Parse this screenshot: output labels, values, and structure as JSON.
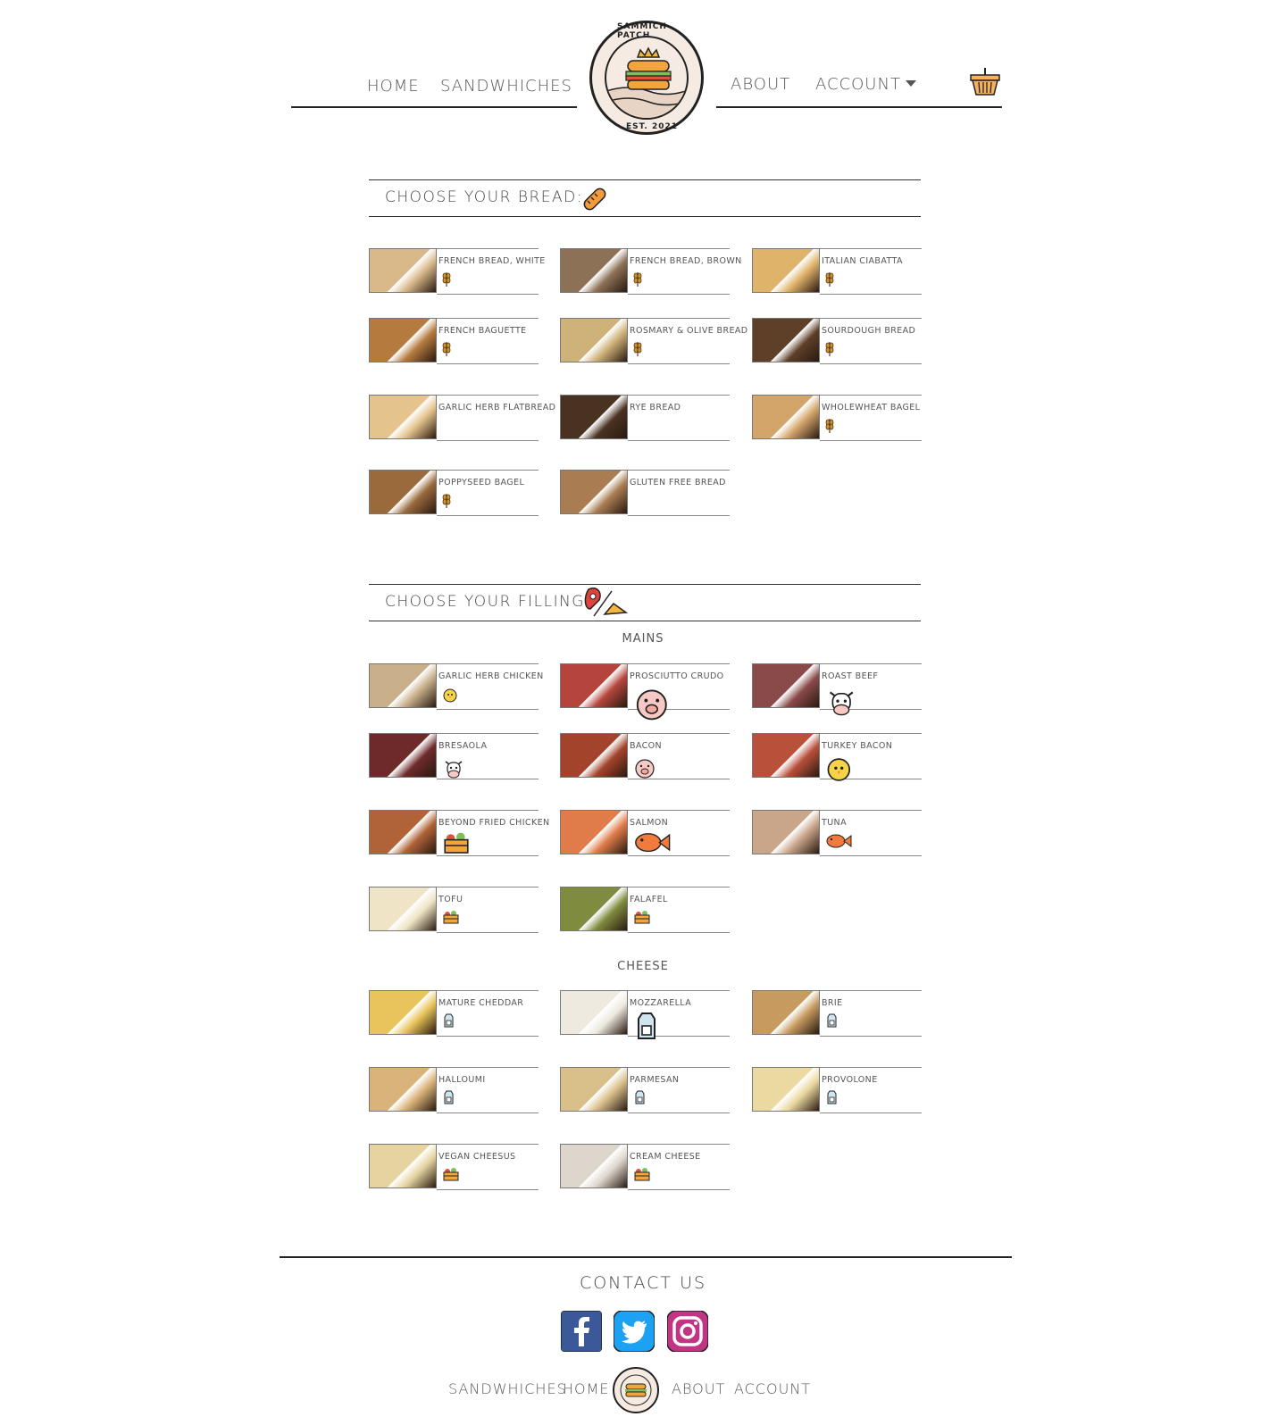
{
  "header": {
    "nav_left": [
      "HOME",
      "SANDWHICHES"
    ],
    "nav_right": [
      "ABOUT",
      "ACCOUNT"
    ],
    "logo_top": "SAMMICH PATCH",
    "logo_bottom": "EST. 2021",
    "basket_icon": "basket-icon"
  },
  "bread_section": {
    "title": "CHOOSE YOUR BREAD:",
    "icon": "bread-icon",
    "items": [
      {
        "name": "FRENCH BREAD, WHITE",
        "badge": "wheat",
        "photo": "#d9b98a"
      },
      {
        "name": "FRENCH BREAD, BROWN",
        "badge": "wheat",
        "photo": "#8c7156"
      },
      {
        "name": "ITALIAN CIABATTA",
        "badge": "wheat",
        "photo": "#e0b36a"
      },
      {
        "name": "FRENCH BAGUETTE",
        "badge": "wheat",
        "photo": "#b57a3e"
      },
      {
        "name": "ROSMARY & OLIVE BREAD",
        "badge": "wheat",
        "photo": "#cfb27a"
      },
      {
        "name": "SOURDOUGH BREAD",
        "badge": "wheat",
        "photo": "#5e3f28"
      },
      {
        "name": "GARLIC HERB FLATBREAD",
        "badge": "",
        "photo": "#e4c38d"
      },
      {
        "name": "RYE BREAD",
        "badge": "",
        "photo": "#4a3222"
      },
      {
        "name": "WHOLEWHEAT BAGEL",
        "badge": "wheat",
        "photo": "#d3a56b"
      },
      {
        "name": "POPPYSEED BAGEL",
        "badge": "wheat",
        "photo": "#9a6a3c"
      },
      {
        "name": "GLUTEN FREE BREAD",
        "badge": "",
        "photo": "#a97c52"
      }
    ]
  },
  "filling_section": {
    "title": "CHOOSE YOUR FILLING:",
    "icon": "meat-cheese-icon",
    "mains_label": "MAINS",
    "mains": [
      {
        "name": "GARLIC HERB CHICKEN",
        "badge": "chick",
        "photo": "#c9b08a"
      },
      {
        "name": "PROSCIUTTO CRUDO",
        "badge": "pig",
        "photo": "#b5453c"
      },
      {
        "name": "ROAST BEEF",
        "badge": "cow",
        "photo": "#8b4a4a"
      },
      {
        "name": "BRESAOLA",
        "badge": "cow",
        "photo": "#6e2a2a"
      },
      {
        "name": "BACON",
        "badge": "pig",
        "photo": "#a3432b"
      },
      {
        "name": "TURKEY BACON",
        "badge": "chick",
        "photo": "#b8503a"
      },
      {
        "name": "BEYOND FRIED CHICKEN",
        "badge": "veg",
        "photo": "#b06338"
      },
      {
        "name": "SALMON",
        "badge": "fish",
        "photo": "#e07c4a"
      },
      {
        "name": "TUNA",
        "badge": "fish",
        "photo": "#c9a58a"
      },
      {
        "name": "TOFU",
        "badge": "veg",
        "photo": "#efe4c5"
      },
      {
        "name": "FALAFEL",
        "badge": "veg",
        "photo": "#7f8b3e"
      }
    ],
    "cheese_label": "CHEESE",
    "cheese": [
      {
        "name": "MATURE CHEDDAR",
        "badge": "milk",
        "photo": "#e8c45a"
      },
      {
        "name": "MOZZARELLA",
        "badge": "milk",
        "photo": "#efeae0"
      },
      {
        "name": "BRIE",
        "badge": "milk",
        "photo": "#c79a60"
      },
      {
        "name": "HALLOUMI",
        "badge": "milk",
        "photo": "#d9b37a"
      },
      {
        "name": "PARMESAN",
        "badge": "milk",
        "photo": "#d9c08a"
      },
      {
        "name": "PROVOLONE",
        "badge": "milk",
        "photo": "#ead9a0"
      },
      {
        "name": "VEGAN CHEESUS",
        "badge": "veg",
        "photo": "#e5d4a0"
      },
      {
        "name": "CREAM CHEESE",
        "badge": "veg",
        "photo": "#ddd6cc"
      }
    ]
  },
  "footer": {
    "contact": "CONTACT US",
    "social": [
      "facebook-icon",
      "twitter-icon",
      "instagram-icon"
    ],
    "nav": [
      "SANDWHICHES",
      "HOME",
      "ABOUT",
      "ACCOUNT"
    ]
  }
}
